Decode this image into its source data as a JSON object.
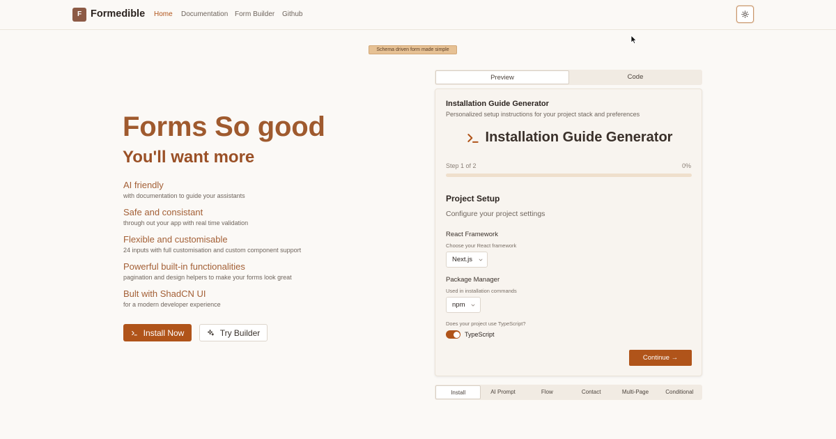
{
  "header": {
    "logo_letter": "F",
    "brand": "Formedible",
    "nav": [
      {
        "label": "Home",
        "active": true
      },
      {
        "label": "Documentation",
        "active": false
      },
      {
        "label": "Form Builder",
        "active": false
      },
      {
        "label": "Github",
        "active": false
      }
    ],
    "theme_icon": "sun-icon"
  },
  "badge": "Schema driven form made simple",
  "hero": {
    "title": "Forms So good",
    "subtitle": "You'll want more",
    "features": [
      {
        "title": "AI friendly",
        "desc": "with documentation to guide your assistants"
      },
      {
        "title": "Safe and consistant",
        "desc": "through out your app with real time validation"
      },
      {
        "title": "Flexible and customisable",
        "desc": "24 inputs with full customisation and custom component support"
      },
      {
        "title": "Powerful built-in functionalities",
        "desc": "pagination and design helpers to make your forms look great"
      },
      {
        "title": "Bult with ShadCN UI",
        "desc": "for a modern developer experience"
      }
    ],
    "install_button": "Install Now",
    "builder_button": "Try Builder"
  },
  "demo_tabs": [
    {
      "label": "Preview",
      "active": true
    },
    {
      "label": "Code",
      "active": false
    }
  ],
  "form": {
    "card_title": "Installation Guide Generator",
    "card_subtitle": "Personalized setup instructions for your project stack and preferences",
    "big_title": "Installation Guide Generator",
    "step_text": "Step 1 of 2",
    "progress_label": "0%",
    "progress_value": 0,
    "section_title": "Project Setup",
    "section_desc": "Configure your project settings",
    "framework": {
      "label": "React Framework",
      "help": "Choose your React framework",
      "value": "Next.js"
    },
    "package_manager": {
      "label": "Package Manager",
      "help": "Used in installation commands",
      "value": "npm"
    },
    "typescript": {
      "question": "Does your project use TypeScript?",
      "label": "TypeScript",
      "checked": true
    },
    "continue_button": "Continue →"
  },
  "example_tabs": [
    {
      "label": "Install",
      "active": true
    },
    {
      "label": "AI Prompt",
      "active": false
    },
    {
      "label": "Flow",
      "active": false
    },
    {
      "label": "Contact",
      "active": false
    },
    {
      "label": "Multi-Page",
      "active": false
    },
    {
      "label": "Conditional",
      "active": false
    }
  ],
  "colors": {
    "accent": "#b0541a",
    "heading": "#9f5a2e",
    "background": "#fbf9f6"
  }
}
